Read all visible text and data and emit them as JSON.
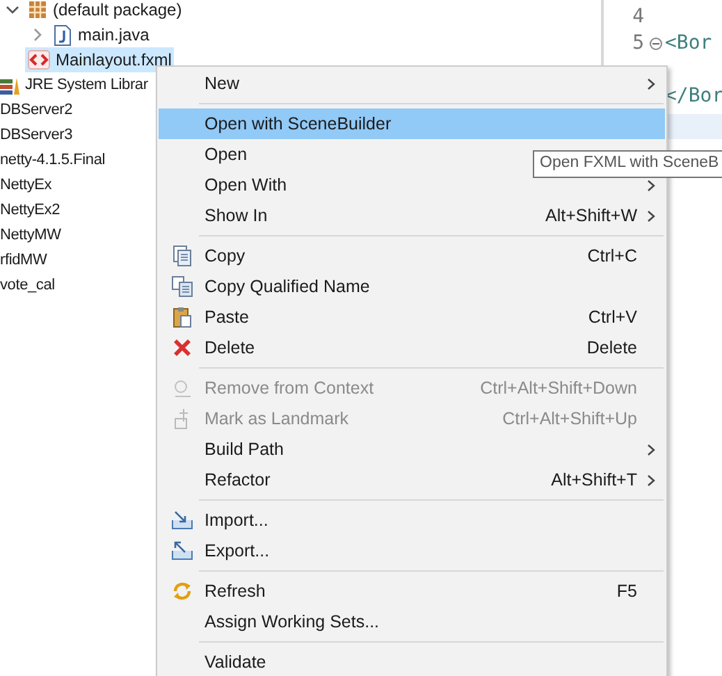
{
  "tree": [
    {
      "label": "(default package)",
      "selected": false,
      "expanded": true,
      "children": [
        {
          "label": "main.java",
          "selected": false,
          "expanded": false
        }
      ]
    },
    {
      "label": "Mainlayout.fxml",
      "selected": true
    }
  ],
  "projects": [
    {
      "label": "JRE System Librar",
      "selected": false
    },
    {
      "label": "DBServer2",
      "selected": false
    },
    {
      "label": "DBServer3",
      "selected": false
    },
    {
      "label": "netty-4.1.5.Final",
      "selected": false
    },
    {
      "label": "NettyEx",
      "selected": false
    },
    {
      "label": "NettyEx2",
      "selected": false
    },
    {
      "label": "NettyMW",
      "selected": false
    },
    {
      "label": "rfidMW",
      "selected": false
    },
    {
      "label": "vote_cal",
      "selected": false
    }
  ],
  "editor": {
    "lines": [
      {
        "number": "4"
      },
      {
        "number": "5",
        "code": "<Bor",
        "foldable": true
      },
      {
        "code": "</Bor"
      }
    ]
  },
  "context_menu": {
    "groups": [
      {
        "items": [
          {
            "label": "New",
            "submenu": true,
            "selected": false,
            "disabled": false
          }
        ]
      },
      {
        "items": [
          {
            "label": "Open with SceneBuilder",
            "submenu": false,
            "selected": true,
            "disabled": false
          },
          {
            "label": "Open",
            "submenu": false,
            "selected": false,
            "disabled": false
          },
          {
            "label": "Open With",
            "submenu": true,
            "selected": false,
            "disabled": false
          },
          {
            "label": "Show In",
            "shortcut": "Alt+Shift+W",
            "submenu": true,
            "selected": false,
            "disabled": false
          }
        ]
      },
      {
        "items": [
          {
            "label": "Copy",
            "shortcut": "Ctrl+C",
            "submenu": false,
            "selected": false,
            "disabled": false
          },
          {
            "label": "Copy Qualified Name",
            "submenu": false,
            "selected": false,
            "disabled": false
          },
          {
            "label": "Paste",
            "shortcut": "Ctrl+V",
            "submenu": false,
            "selected": false,
            "disabled": false
          },
          {
            "label": "Delete",
            "shortcut": "Delete",
            "submenu": false,
            "selected": false,
            "disabled": false
          }
        ]
      },
      {
        "items": [
          {
            "label": "Remove from Context",
            "shortcut": "Ctrl+Alt+Shift+Down",
            "submenu": false,
            "selected": false,
            "disabled": true
          },
          {
            "label": "Mark as Landmark",
            "shortcut": "Ctrl+Alt+Shift+Up",
            "submenu": false,
            "selected": false,
            "disabled": true
          },
          {
            "label": "Build Path",
            "submenu": true,
            "selected": false,
            "disabled": false
          },
          {
            "label": "Refactor",
            "shortcut": "Alt+Shift+T",
            "submenu": true,
            "selected": false,
            "disabled": false
          }
        ]
      },
      {
        "items": [
          {
            "label": "Import...",
            "submenu": false,
            "selected": false,
            "disabled": false
          },
          {
            "label": "Export...",
            "submenu": false,
            "selected": false,
            "disabled": false
          }
        ]
      },
      {
        "items": [
          {
            "label": "Refresh",
            "shortcut": "F5",
            "submenu": false,
            "selected": false,
            "disabled": false
          },
          {
            "label": "Assign Working Sets...",
            "submenu": false,
            "selected": false,
            "disabled": false
          }
        ]
      },
      {
        "items": [
          {
            "label": "Validate",
            "submenu": false,
            "selected": false,
            "disabled": false
          }
        ]
      }
    ]
  },
  "tooltip": {
    "text": "Open FXML with SceneB"
  }
}
